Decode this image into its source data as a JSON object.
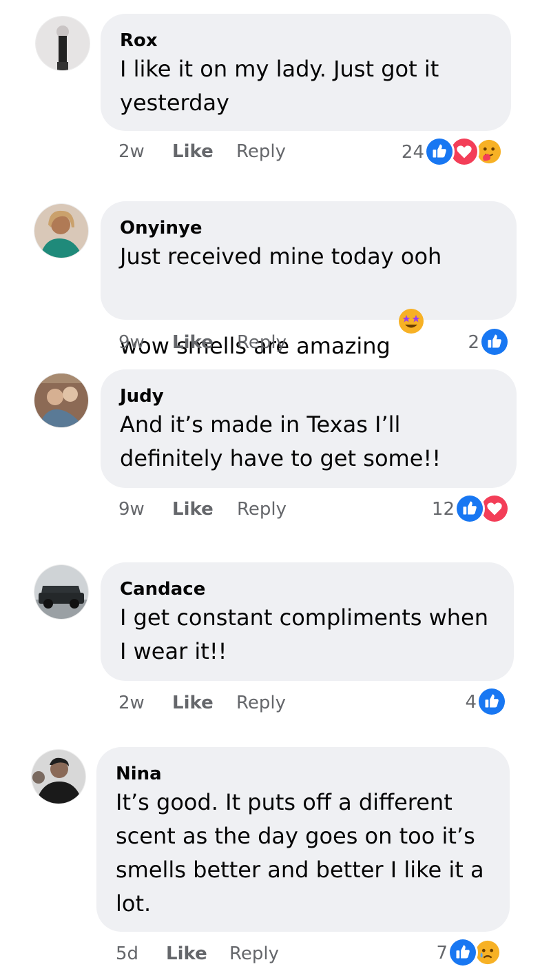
{
  "colors": {
    "bubble": "#eff0f3",
    "meta": "#65676b",
    "like_blue": "#1877f2",
    "love_red": "#f33e58",
    "emoji_yellow": "#f7b125"
  },
  "comments": [
    {
      "name": "Rox",
      "text": "I like it on my lady. Just got it\nyesterday",
      "time": "2w",
      "like_label": "Like",
      "reply_label": "Reply",
      "reaction_count": "24",
      "reactions": [
        "like-icon",
        "love-icon",
        "care-icon"
      ]
    },
    {
      "name": "Onyinye",
      "text": "Just received mine today ooh\nwow smells are amazing",
      "text_emoji": "star-struck-emoji",
      "time": "9w",
      "like_label": "Like",
      "reply_label": "Reply",
      "reaction_count": "2",
      "reactions": [
        "like-icon"
      ]
    },
    {
      "name": "Judy",
      "text": "And it’s made in Texas I’ll\ndefinitely have to get some!!",
      "time": "9w",
      "like_label": "Like",
      "reply_label": "Reply",
      "reaction_count": "12",
      "reactions": [
        "like-icon",
        "love-icon"
      ]
    },
    {
      "name": "Candace",
      "text": "I get constant compliments when\nI wear it!!",
      "time": "2w",
      "like_label": "Like",
      "reply_label": "Reply",
      "reaction_count": "4",
      "reactions": [
        "like-icon"
      ]
    },
    {
      "name": "Nina",
      "text": "It’s good. It puts off a different\nscent as the day goes on too it’s\nsmells better and better I like it a\nlot.",
      "time": "5d",
      "like_label": "Like",
      "reply_label": "Reply",
      "reaction_count": "7",
      "reactions": [
        "like-icon",
        "sad-icon"
      ]
    }
  ]
}
